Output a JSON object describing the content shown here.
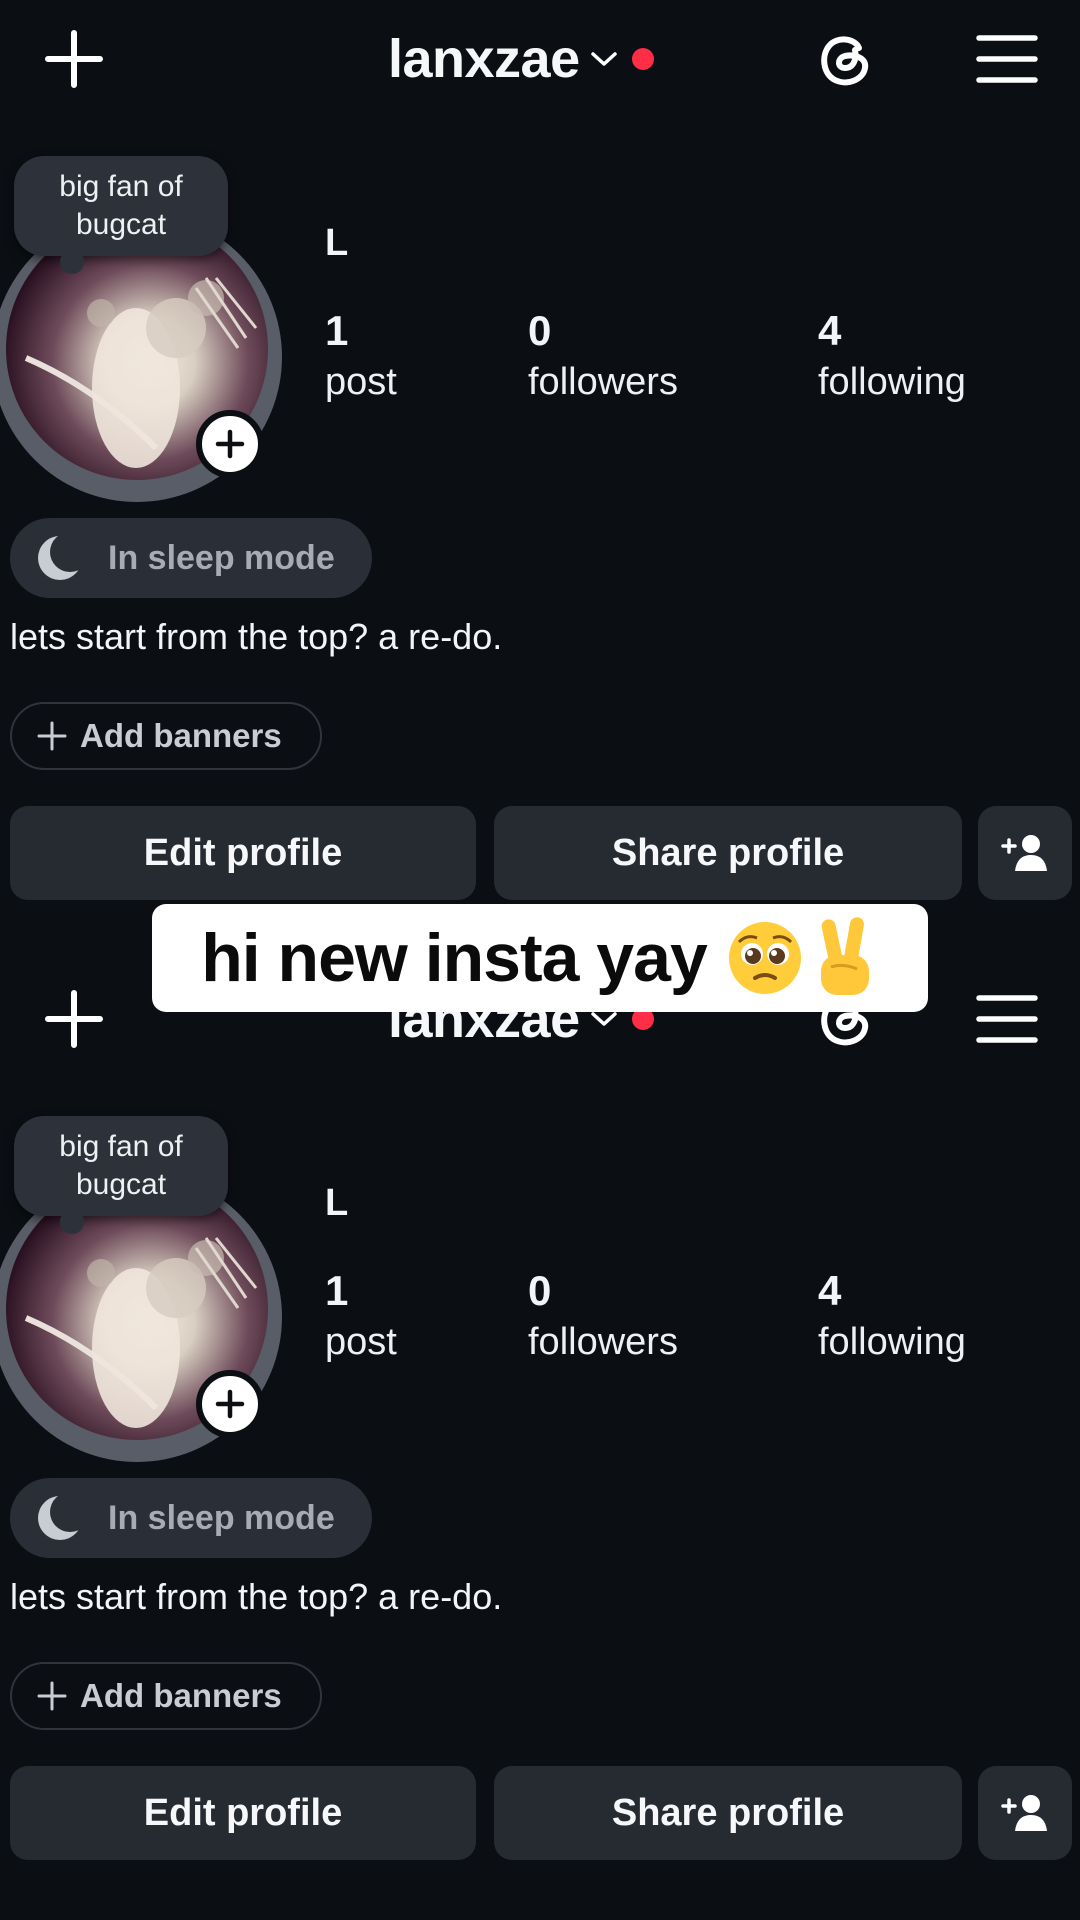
{
  "profiles": [
    {
      "username": "lanxzae",
      "note_lines": [
        "big fan of",
        "bugcat"
      ],
      "display_name": "L",
      "stats": {
        "posts": {
          "value": "1",
          "label": "post"
        },
        "followers": {
          "value": "0",
          "label": "followers"
        },
        "following": {
          "value": "4",
          "label": "following"
        }
      },
      "sleep_label": "In sleep mode",
      "bio": "lets start from the top? a re-do.",
      "banners_label": "Add banners",
      "edit_label": "Edit profile",
      "share_label": "Share profile"
    },
    {
      "username": "lanxzae",
      "note_lines": [
        "big fan of",
        "bugcat"
      ],
      "display_name": "L",
      "stats": {
        "posts": {
          "value": "1",
          "label": "post"
        },
        "followers": {
          "value": "0",
          "label": "followers"
        },
        "following": {
          "value": "4",
          "label": "following"
        }
      },
      "sleep_label": "In sleep mode",
      "bio": "lets start from the top? a re-do.",
      "banners_label": "Add banners",
      "edit_label": "Edit profile",
      "share_label": "Share profile"
    }
  ],
  "caption": {
    "text": "hi new insta yay",
    "emojis": [
      "pleading-face-icon",
      "victory-hand-icon"
    ]
  },
  "colors": {
    "background": "#0b0e13",
    "button": "#262a31",
    "notification": "#ff2d45",
    "muted_text": "#a6abb4"
  }
}
